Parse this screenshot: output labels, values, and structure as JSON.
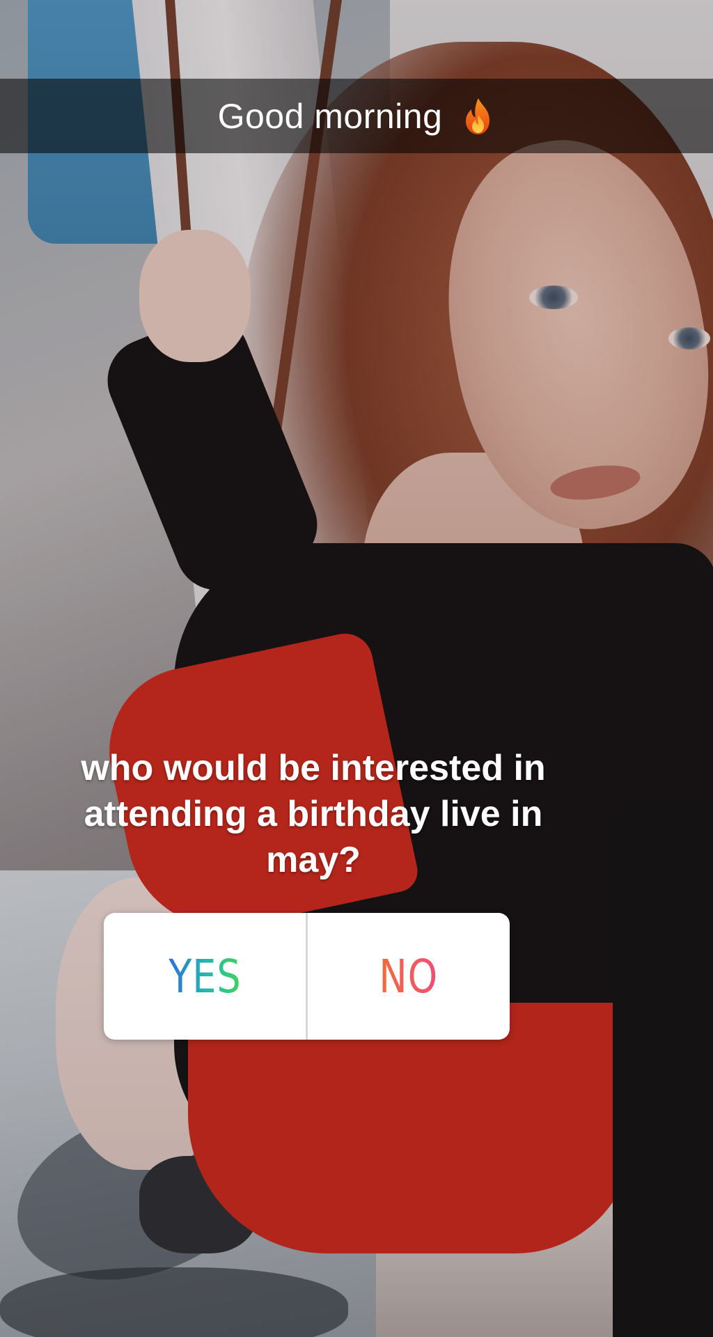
{
  "story": {
    "caption": {
      "text": "Good morning",
      "icon": "fire-emoji"
    },
    "question": {
      "lines": [
        "who would be interested in",
        "attending a birthday live in",
        "may?"
      ]
    },
    "poll": {
      "yes_label": "YES",
      "no_label": "NO",
      "colors": {
        "yes_gradient": [
          "#2f6fd6",
          "#24b6b0",
          "#3fd35d"
        ],
        "no_gradient": [
          "#f26b3a",
          "#f04e78"
        ],
        "background": "#ffffff"
      }
    }
  }
}
